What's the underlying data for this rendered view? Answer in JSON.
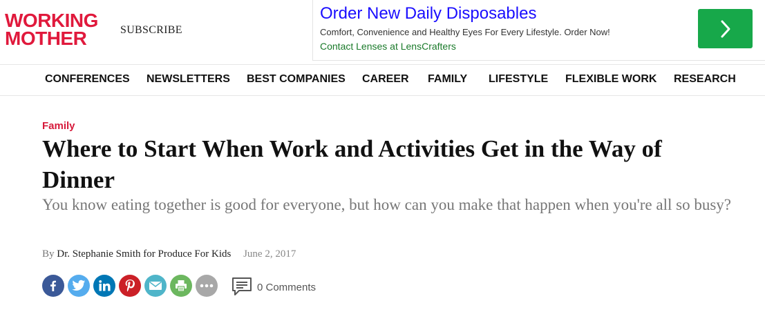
{
  "header": {
    "logo_line1": "WORKING",
    "logo_line2": "MOTHER",
    "subscribe_label": "SUBSCRIBE"
  },
  "ad": {
    "title": "Order New Daily Disposables",
    "description": "Comfort, Convenience and Healthy Eyes For Every Lifestyle. Order Now!",
    "display_url": "Contact Lenses at LensCrafters",
    "cta_icon": "chevron-right-icon"
  },
  "nav": {
    "items": [
      {
        "label": "CONFERENCES"
      },
      {
        "label": "NEWSLETTERS"
      },
      {
        "label": "BEST COMPANIES"
      },
      {
        "label": "CAREER"
      },
      {
        "label": "FAMILY"
      },
      {
        "label": "LIFESTYLE"
      },
      {
        "label": "FLEXIBLE WORK"
      },
      {
        "label": "RESEARCH"
      }
    ]
  },
  "article": {
    "category": "Family",
    "headline": "Where to Start When Work and Activities Get in the Way of Dinner",
    "dek": "You know eating together is good for everyone, but how can you make that happen when you're all so busy?",
    "byline_prefix": "By",
    "author": "Dr. Stephanie Smith for Produce For Kids",
    "date": "June 2, 2017"
  },
  "share": {
    "buttons": [
      {
        "name": "facebook-icon",
        "color": "#3b5998"
      },
      {
        "name": "twitter-icon",
        "color": "#55acee"
      },
      {
        "name": "linkedin-icon",
        "color": "#0077b5"
      },
      {
        "name": "pinterest-icon",
        "color": "#cb2027"
      },
      {
        "name": "email-icon",
        "color": "#4fb5c9"
      },
      {
        "name": "print-icon",
        "color": "#6cb75f"
      },
      {
        "name": "more-icon",
        "color": "#a8a8a8"
      }
    ],
    "comments_label": "0 Comments"
  },
  "colors": {
    "brand": "#e0193c",
    "ad_link": "#1a0dff",
    "ad_url": "#1a7a2a",
    "ad_button": "#17a84a"
  }
}
